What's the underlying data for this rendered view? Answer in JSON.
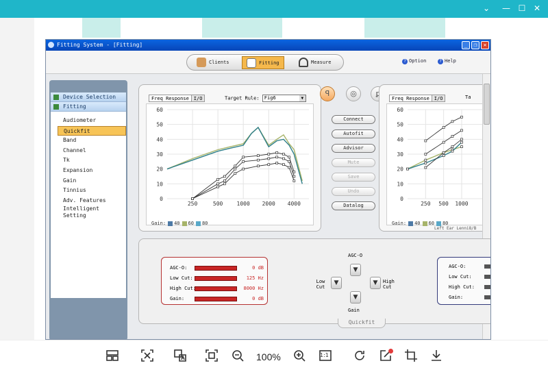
{
  "viewer": {
    "zoom": "100%",
    "tools": [
      "layout-icon",
      "select-text-icon",
      "translate-icon",
      "fit-screen-icon",
      "zoom-out-icon",
      "zoom-in-icon",
      "actual-size-icon",
      "rotate-icon",
      "edit-icon",
      "crop-icon",
      "download-icon"
    ],
    "one_to_one": "1:1"
  },
  "app": {
    "title": "Fitting System - [Fitting]",
    "nav": {
      "clients": "Clients",
      "fitting": "Fitting",
      "measure": "Measure"
    },
    "option": "Option",
    "help": "Help"
  },
  "sidebar": {
    "device_selection": "Device Selection",
    "fitting": "Fitting",
    "items": [
      "Audiometer",
      "Quickfit",
      "Band",
      "Channel",
      "Tk",
      "Expansion",
      "Gain",
      "Tinnius",
      "Adv. Features",
      "Intelligent Setting"
    ],
    "selected": "Quickfit"
  },
  "left_chart": {
    "tab_freq": "Freq Response",
    "tab_io": "I/O",
    "target_rule_label": "Target Rule:",
    "target_rule_value": "Fig6",
    "gain_label": "Gain:",
    "legend": [
      {
        "label": "40",
        "color": "#4d7aa6"
      },
      {
        "label": "60",
        "color": "#a7b46a"
      },
      {
        "label": "80",
        "color": "#59a8c8"
      }
    ]
  },
  "right_chart": {
    "tab_freq": "Freq Response",
    "tab_io": "I/O",
    "target_rule_label": "Ta",
    "gain_label": "Gain:",
    "legend": [
      {
        "label": "40",
        "color": "#4d7aa6"
      },
      {
        "label": "60",
        "color": "#a7b46a"
      },
      {
        "label": "80",
        "color": "#59a8c8"
      }
    ],
    "footer": "Left Ear  Lenni8/B"
  },
  "actions": [
    "Connect",
    "Autofit",
    "Advisor",
    "Mute",
    "Save",
    "Undo",
    "Datalog"
  ],
  "actions_disabled": [
    false,
    false,
    false,
    true,
    true,
    true,
    false
  ],
  "agc": {
    "rows": [
      {
        "label": "AGC-O:",
        "value": "0 dB"
      },
      {
        "label": "Low Cut:",
        "value": "125 Hz"
      },
      {
        "label": "High Cut:",
        "value": "8000 Hz"
      },
      {
        "label": "Gain:",
        "value": "0 dB"
      }
    ]
  },
  "right_agc": {
    "rows": [
      "AGC-O:",
      "Low Cut:",
      "High Cut:",
      "Gain:"
    ]
  },
  "pad": {
    "agc": "AGC-O",
    "low": "Low Cut",
    "high": "High Cut",
    "gain": "Gain"
  },
  "quickfit_tab": "Quickfit",
  "chart_data": [
    {
      "type": "line",
      "x_ticks": [
        250,
        500,
        1000,
        2000,
        4000
      ],
      "y_ticks": [
        0,
        10,
        20,
        30,
        40,
        50,
        60
      ],
      "ylim": [
        0,
        60
      ],
      "legend": [
        "40",
        "60",
        "80"
      ],
      "series": [
        {
          "name": "60",
          "x": [
            125,
            250,
            500,
            700,
            1000,
            1250,
            1500,
            2000,
            2500,
            3000,
            3500,
            4000,
            5000
          ],
          "values": [
            20,
            27,
            33,
            35,
            37,
            44,
            48,
            36,
            40,
            43,
            37,
            33,
            12
          ]
        },
        {
          "name": "80",
          "x": [
            125,
            250,
            500,
            700,
            1000,
            1250,
            1500,
            2000,
            2500,
            3000,
            3500,
            4000,
            5000
          ],
          "values": [
            20,
            26,
            32,
            34,
            36,
            44,
            48,
            35,
            39,
            40,
            36,
            30,
            10
          ]
        },
        {
          "name": "40",
          "x": [
            250,
            500,
            600,
            800,
            1000,
            1500,
            2000,
            2500,
            3000,
            3500,
            4000
          ],
          "values": [
            0,
            13,
            15,
            22,
            28,
            29,
            30,
            31,
            30,
            28,
            18
          ]
        },
        {
          "name": "40",
          "x": [
            250,
            500,
            600,
            800,
            1000,
            1500,
            2000,
            2500,
            3000,
            3500,
            4000
          ],
          "values": [
            0,
            10,
            12,
            20,
            25,
            26,
            27,
            28,
            27,
            25,
            15
          ]
        },
        {
          "name": "40",
          "x": [
            250,
            500,
            600,
            800,
            1000,
            1500,
            2000,
            2500,
            3000,
            3500,
            4000
          ],
          "values": [
            0,
            8,
            10,
            17,
            20,
            22,
            23,
            24,
            23,
            21,
            12
          ]
        }
      ]
    },
    {
      "type": "line",
      "x_ticks": [
        250,
        500,
        1000
      ],
      "y_ticks": [
        0,
        10,
        20,
        30,
        40,
        50,
        60
      ],
      "ylim": [
        0,
        60
      ],
      "legend": [
        "40",
        "60",
        "80"
      ],
      "series": [
        {
          "name": "40",
          "x": [
            125,
            250,
            500,
            700,
            1000
          ],
          "values": [
            20,
            26,
            31,
            33,
            35
          ]
        },
        {
          "name": "60",
          "x": [
            125,
            250,
            500,
            700,
            1000
          ],
          "values": [
            20,
            24,
            29,
            32,
            38
          ]
        },
        {
          "name": "80",
          "x": [
            250,
            500,
            700,
            1000
          ],
          "values": [
            39,
            48,
            52,
            55
          ]
        },
        {
          "name": "40",
          "x": [
            250,
            500,
            700,
            1000
          ],
          "values": [
            30,
            38,
            42,
            46
          ]
        },
        {
          "name": "40",
          "x": [
            250,
            500,
            700,
            1000
          ],
          "values": [
            21,
            31,
            35,
            40
          ]
        }
      ]
    }
  ]
}
